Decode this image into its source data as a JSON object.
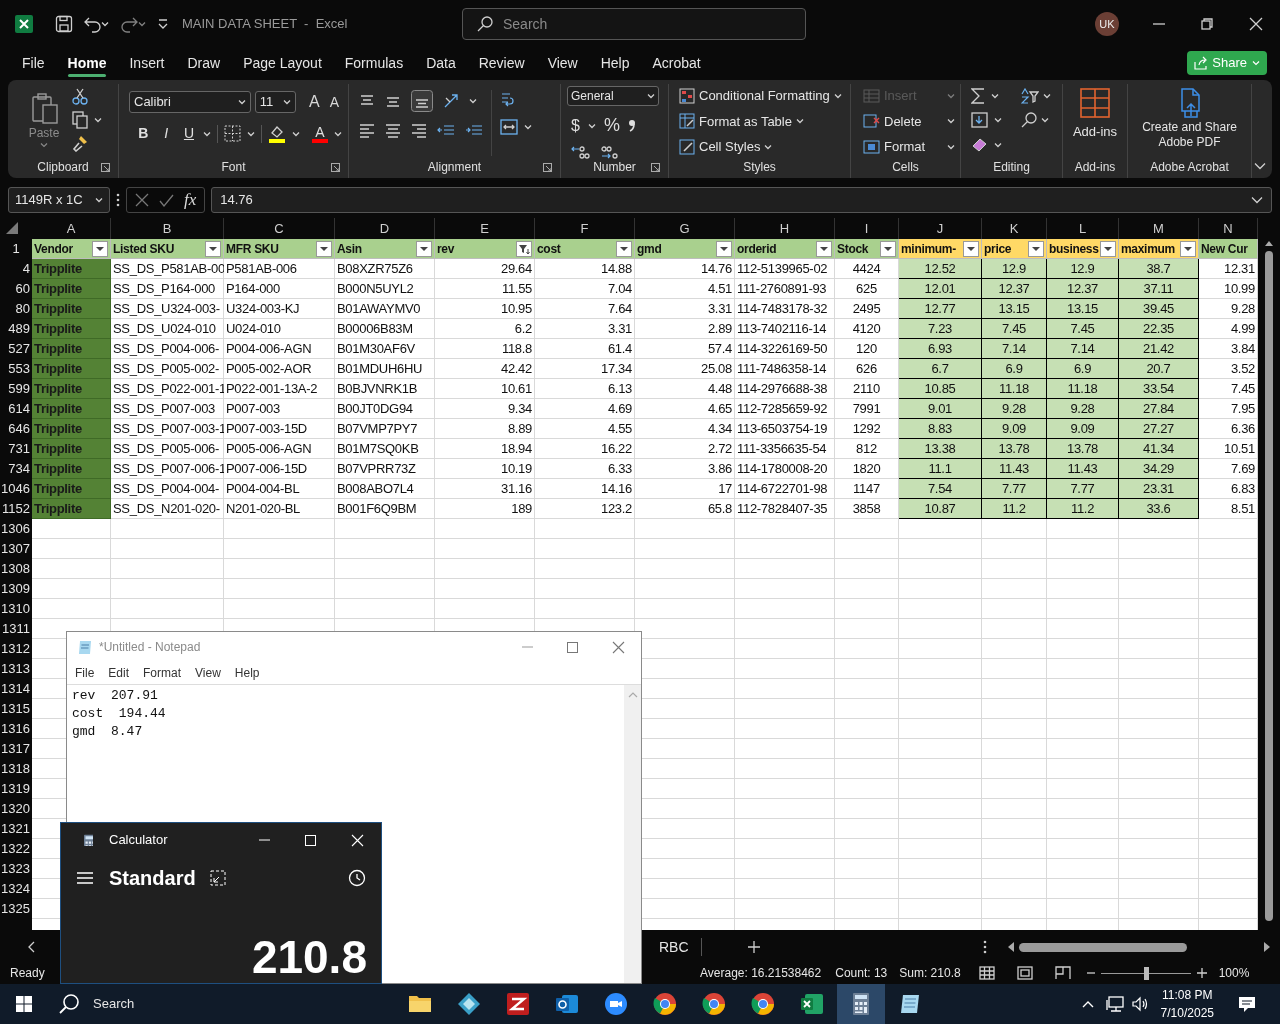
{
  "title_bar": {
    "title": "MAIN DATA SHEET  -  Excel",
    "search_placeholder": "Search",
    "avatar": "UK"
  },
  "menu_tabs": [
    {
      "label": "File",
      "selected": false
    },
    {
      "label": "Home",
      "selected": true
    },
    {
      "label": "Insert",
      "selected": false
    },
    {
      "label": "Draw",
      "selected": false
    },
    {
      "label": "Page Layout",
      "selected": false
    },
    {
      "label": "Formulas",
      "selected": false
    },
    {
      "label": "Data",
      "selected": false
    },
    {
      "label": "Review",
      "selected": false
    },
    {
      "label": "View",
      "selected": false
    },
    {
      "label": "Help",
      "selected": false
    },
    {
      "label": "Acrobat",
      "selected": false
    }
  ],
  "share_button": "Share",
  "ribbon": {
    "clipboard": {
      "paste": "Paste",
      "label": "Clipboard"
    },
    "font": {
      "name": "Calibri",
      "size": "11",
      "grow": "A",
      "shrink": "A",
      "styles": [
        "B",
        "I",
        "U"
      ],
      "color_letter": "A",
      "label": "Font"
    },
    "alignment": {
      "label": "Alignment"
    },
    "number": {
      "format": "General",
      "symbols": [
        "$",
        "%"
      ],
      "label": "Number"
    },
    "styles": {
      "buttons": [
        "Conditional Formatting",
        "Format as Table",
        "Cell Styles"
      ],
      "label": "Styles"
    },
    "cells": {
      "buttons": [
        {
          "label": "Insert",
          "disabled": true
        },
        {
          "label": "Delete",
          "disabled": false
        },
        {
          "label": "Format",
          "disabled": false
        }
      ],
      "label": "Cells"
    },
    "editing": {
      "label": "Editing"
    },
    "addins": {
      "button": "Add-ins",
      "label": "Add-ins"
    },
    "acrobat": {
      "button": "Create and Share Adobe PDF",
      "label": "Adobe Acrobat"
    }
  },
  "formula_bar": {
    "name_box": "1149R x 1C",
    "fx": "fx",
    "value": "14.76"
  },
  "sheet": {
    "columns": [
      {
        "letter": "A",
        "header": "Vendor",
        "color": "#a9d08e",
        "filtered": false
      },
      {
        "letter": "B",
        "header": "Listed SKU",
        "color": "#a9d08e",
        "filtered": false
      },
      {
        "letter": "C",
        "header": "MFR SKU",
        "color": "#a9d08e",
        "filtered": false
      },
      {
        "letter": "D",
        "header": "Asin",
        "color": "#a9d08e",
        "filtered": false
      },
      {
        "letter": "E",
        "header": "rev",
        "color": "#a9d08e",
        "filtered": true
      },
      {
        "letter": "F",
        "header": "cost",
        "color": "#a9d08e",
        "filtered": false
      },
      {
        "letter": "G",
        "header": "gmd",
        "color": "#a9d08e",
        "filtered": false
      },
      {
        "letter": "H",
        "header": "orderid",
        "color": "#a9d08e",
        "filtered": false
      },
      {
        "letter": "I",
        "header": "Stock",
        "color": "#a9d08e",
        "filtered": false
      },
      {
        "letter": "J",
        "header": "minimum-",
        "color": "#ffd966",
        "filtered": false
      },
      {
        "letter": "K",
        "header": "price",
        "color": "#ffd966",
        "filtered": false
      },
      {
        "letter": "L",
        "header": "business",
        "color": "#ffd966",
        "filtered": false
      },
      {
        "letter": "M",
        "header": "maximum",
        "color": "#ffd966",
        "filtered": false
      },
      {
        "letter": "N",
        "header": "New Cur",
        "color": "#a9d08e"
      }
    ],
    "header_row": "1",
    "rows": [
      {
        "row": "4",
        "cells": [
          "Tripplite",
          "SS_DS_P581AB-00",
          "P581AB-006",
          "B08XZR75Z6",
          "29.64",
          "14.88",
          "14.76",
          "112-5139965-02",
          "4424",
          "12.52",
          "12.9",
          "12.9",
          "38.7",
          "12.31"
        ]
      },
      {
        "row": "60",
        "cells": [
          "Tripplite",
          "SS_DS_P164-000",
          "P164-000",
          "B000N5UYL2",
          "11.55",
          "7.04",
          "4.51",
          "111-2760891-93",
          "625",
          "12.01",
          "12.37",
          "12.37",
          "37.11",
          "10.99"
        ]
      },
      {
        "row": "80",
        "cells": [
          "Tripplite",
          "SS_DS_U324-003-",
          "U324-003-KJ",
          "B01AWAYMV0",
          "10.95",
          "7.64",
          "3.31",
          "114-7483178-32",
          "2495",
          "12.77",
          "13.15",
          "13.15",
          "39.45",
          "9.28"
        ]
      },
      {
        "row": "489",
        "cells": [
          "Tripplite",
          "SS_DS_U024-010",
          "U024-010",
          "B00006B83M",
          "6.2",
          "3.31",
          "2.89",
          "113-7402116-14",
          "4120",
          "7.23",
          "7.45",
          "7.45",
          "22.35",
          "4.99"
        ]
      },
      {
        "row": "527",
        "cells": [
          "Tripplite",
          "SS_DS_P004-006-",
          "P004-006-AGN",
          "B01M30AF6V",
          "118.8",
          "61.4",
          "57.4",
          "114-3226169-50",
          "120",
          "6.93",
          "7.14",
          "7.14",
          "21.42",
          "3.84"
        ]
      },
      {
        "row": "553",
        "cells": [
          "Tripplite",
          "SS_DS_P005-002-",
          "P005-002-AOR",
          "B01MDUH6HU",
          "42.42",
          "17.34",
          "25.08",
          "111-7486358-14",
          "626",
          "6.7",
          "6.9",
          "6.9",
          "20.7",
          "3.52"
        ]
      },
      {
        "row": "599",
        "cells": [
          "Tripplite",
          "SS_DS_P022-001-1",
          "P022-001-13A-2",
          "B0BJVNRK1B",
          "10.61",
          "6.13",
          "4.48",
          "114-2976688-38",
          "2110",
          "10.85",
          "11.18",
          "11.18",
          "33.54",
          "7.45"
        ]
      },
      {
        "row": "614",
        "cells": [
          "Tripplite",
          "SS_DS_P007-003",
          "P007-003",
          "B00JT0DG94",
          "9.34",
          "4.69",
          "4.65",
          "112-7285659-92",
          "7991",
          "9.01",
          "9.28",
          "9.28",
          "27.84",
          "7.95"
        ]
      },
      {
        "row": "646",
        "cells": [
          "Tripplite",
          "SS_DS_P007-003-1",
          "P007-003-15D",
          "B07VMP7PY7",
          "8.89",
          "4.55",
          "4.34",
          "113-6503754-19",
          "1292",
          "8.83",
          "9.09",
          "9.09",
          "27.27",
          "6.36"
        ]
      },
      {
        "row": "731",
        "cells": [
          "Tripplite",
          "SS_DS_P005-006-",
          "P005-006-AGN",
          "B01M7SQ0KB",
          "18.94",
          "16.22",
          "2.72",
          "111-3356635-54",
          "812",
          "13.38",
          "13.78",
          "13.78",
          "41.34",
          "10.51"
        ]
      },
      {
        "row": "734",
        "cells": [
          "Tripplite",
          "SS_DS_P007-006-1",
          "P007-006-15D",
          "B07VPRR73Z",
          "10.19",
          "6.33",
          "3.86",
          "114-1780008-20",
          "1820",
          "11.1",
          "11.43",
          "11.43",
          "34.29",
          "7.69"
        ]
      },
      {
        "row": "1046",
        "cells": [
          "Tripplite",
          "SS_DS_P004-004-",
          "P004-004-BL",
          "B008ABO7L4",
          "31.16",
          "14.16",
          "17",
          "114-6722701-98",
          "1147",
          "7.54",
          "7.77",
          "7.77",
          "23.31",
          "6.83"
        ]
      },
      {
        "row": "1152",
        "cells": [
          "Tripplite",
          "SS_DS_N201-020-",
          "N201-020-BL",
          "B001F6Q9BM",
          "189",
          "123.2",
          "65.8",
          "112-7828407-35",
          "3858",
          "10.87",
          "11.2",
          "11.2",
          "33.6",
          "8.51"
        ]
      }
    ],
    "empty_rows": [
      "1306",
      "1307",
      "1308",
      "1309",
      "1310",
      "1311",
      "1312",
      "1313",
      "1314",
      "1315",
      "1316",
      "1317",
      "1318",
      "1319",
      "1320",
      "1321",
      "1322",
      "1323",
      "1324",
      "1325"
    ]
  },
  "sheet_tabs": [
    {
      "label": "RBC",
      "selected": false
    }
  ],
  "status_bar": {
    "mode": "Ready",
    "average": "Average: 16.21538462",
    "count": "Count: 13",
    "sum": "Sum: 210.8",
    "zoom": "100%",
    "zoom_slider": {
      "level": 0.5
    }
  },
  "notepad": {
    "title": "*Untitled - Notepad",
    "menu": [
      "File",
      "Edit",
      "Format",
      "View",
      "Help"
    ],
    "lines": [
      "rev  207.91",
      "cost  194.44",
      "gmd  8.47"
    ]
  },
  "calculator": {
    "title": "Calculator",
    "mode": "Standard",
    "display": "210.8"
  },
  "taskbar": {
    "search": "Search",
    "apps": [
      {
        "kind": "folder",
        "selected": false
      },
      {
        "kind": "diamond",
        "selected": false
      },
      {
        "kind": "ftp",
        "selected": false
      },
      {
        "kind": "mail",
        "selected": false
      },
      {
        "kind": "video",
        "selected": false
      },
      {
        "kind": "browser",
        "selected": false
      },
      {
        "kind": "browser",
        "selected": false
      },
      {
        "kind": "browser",
        "selected": false
      },
      {
        "kind": "sheet",
        "selected": false
      },
      {
        "kind": "calculator",
        "selected": true
      },
      {
        "kind": "notepad",
        "selected": false
      }
    ],
    "time": "11:08 PM",
    "date": "7/10/2025"
  }
}
